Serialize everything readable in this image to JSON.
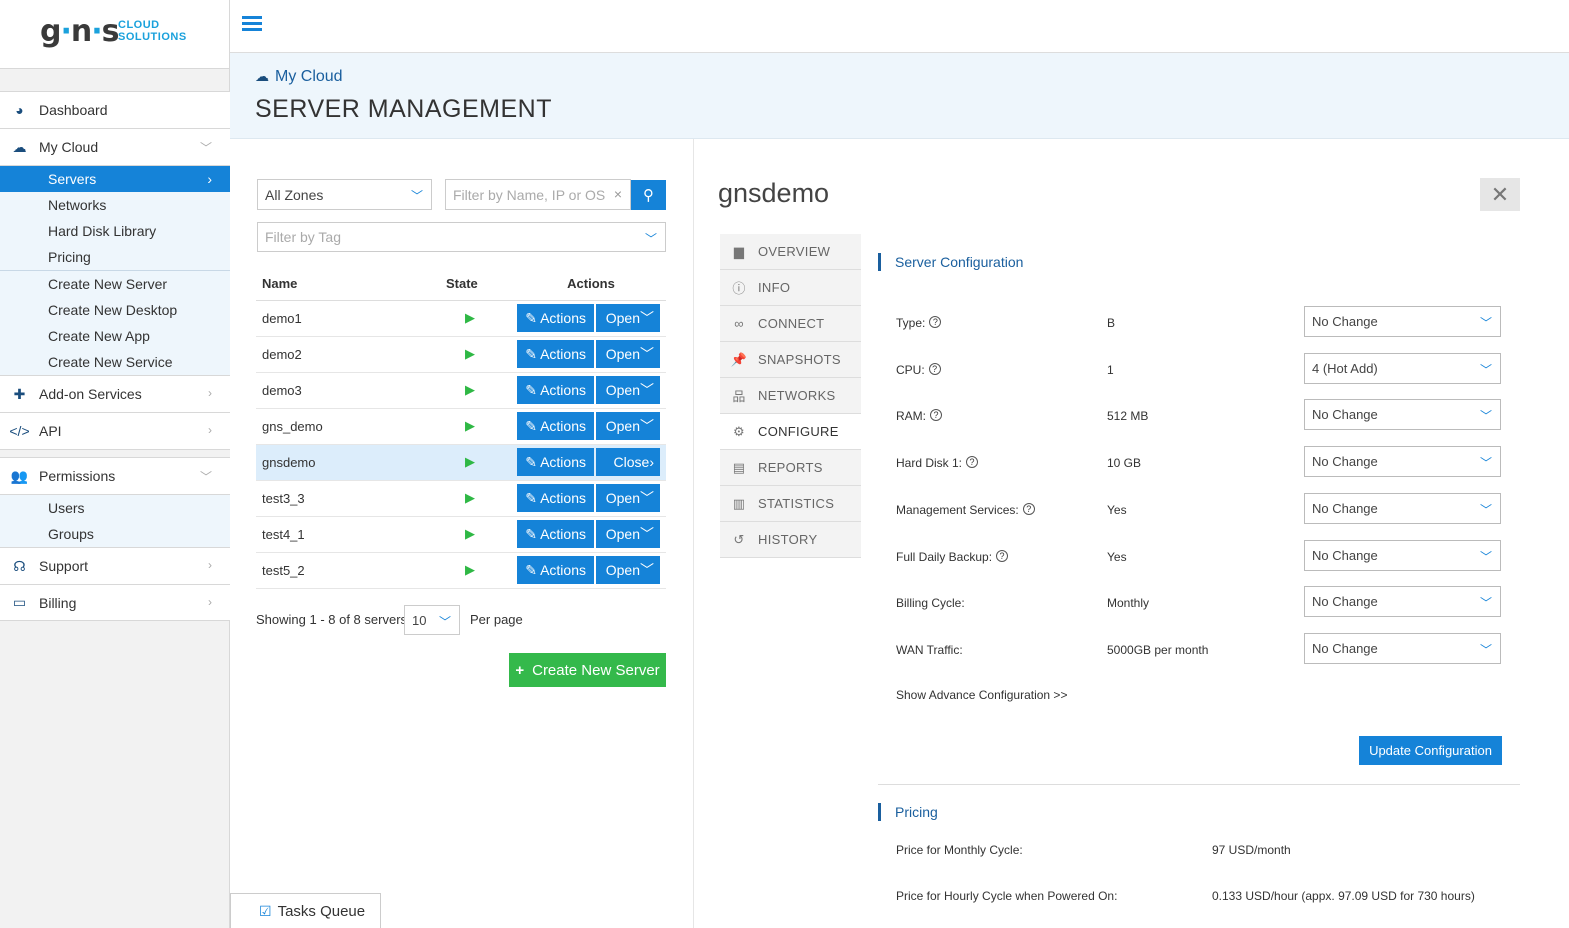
{
  "logo": {
    "main_a": "g",
    "main_b": "n",
    "main_c": "s",
    "sub1": "CLOUD",
    "sub2": "SOLUTIONS"
  },
  "sidebar": {
    "dashboard": "Dashboard",
    "mycloud": "My Cloud",
    "mycloud_items": [
      "Servers",
      "Networks",
      "Hard Disk Library",
      "Pricing"
    ],
    "create_items": [
      "Create New Server",
      "Create New Desktop",
      "Create New App",
      "Create New Service"
    ],
    "addon": "Add-on Services",
    "api": "API",
    "permissions": "Permissions",
    "perm_items": [
      "Users",
      "Groups"
    ],
    "support": "Support",
    "billing": "Billing"
  },
  "header": {
    "crumb": "My Cloud",
    "title": "SERVER MANAGEMENT"
  },
  "filters": {
    "zone": "All Zones",
    "search_placeholder": "Filter by Name, IP or OS",
    "tag_placeholder": "Filter by Tag"
  },
  "table": {
    "col_name": "Name",
    "col_state": "State",
    "col_actions": "Actions",
    "actions_label": "Actions",
    "open_label": "Open",
    "close_label": "Close",
    "rows": [
      "demo1",
      "demo2",
      "demo3",
      "gns_demo",
      "gnsdemo",
      "test3_3",
      "test4_1",
      "test5_2"
    ]
  },
  "pager": {
    "showing": "Showing 1 - 8 of 8 servers,",
    "per_page_value": "10",
    "per_page_label": "Per page"
  },
  "create_button": "Create New Server",
  "tasks_queue": "Tasks Queue",
  "detail": {
    "server_name": "gnsdemo",
    "tabs": [
      "OVERVIEW",
      "INFO",
      "CONNECT",
      "SNAPSHOTS",
      "NETWORKS",
      "CONFIGURE",
      "REPORTS",
      "STATISTICS",
      "HISTORY"
    ],
    "config_title": "Server Configuration",
    "config_rows": [
      {
        "label": "Type:",
        "help": true,
        "value": "B",
        "select": "No Change"
      },
      {
        "label": "CPU:",
        "help": true,
        "value": "1",
        "select": "4 (Hot Add)"
      },
      {
        "label": "RAM:",
        "help": true,
        "value": "512 MB",
        "select": "No Change"
      },
      {
        "label": "Hard Disk 1:",
        "help": true,
        "value": "10 GB",
        "select": "No Change"
      },
      {
        "label": "Management Services:",
        "help": true,
        "value": "Yes",
        "select": "No Change"
      },
      {
        "label": "Full Daily Backup:",
        "help": true,
        "value": "Yes",
        "select": "No Change"
      },
      {
        "label": "Billing Cycle:",
        "help": false,
        "value": "Monthly",
        "select": "No Change"
      },
      {
        "label": "WAN Traffic:",
        "help": false,
        "value": "5000GB per month",
        "select": "No Change"
      }
    ],
    "advanced_link": "Show Advance Configuration >>",
    "update_button": "Update Configuration",
    "pricing_title": "Pricing",
    "pricing": [
      {
        "label": "Price for Monthly Cycle:",
        "value": "97 USD/month"
      },
      {
        "label": "Price for Hourly Cycle when Powered On:",
        "value": "0.133 USD/hour (appx. 97.09 USD for 730 hours)"
      }
    ]
  },
  "colors": {
    "primary": "#1583d8",
    "success": "#34b94b",
    "header_bg": "#eef6fc",
    "brand": "#1aa1dc"
  }
}
